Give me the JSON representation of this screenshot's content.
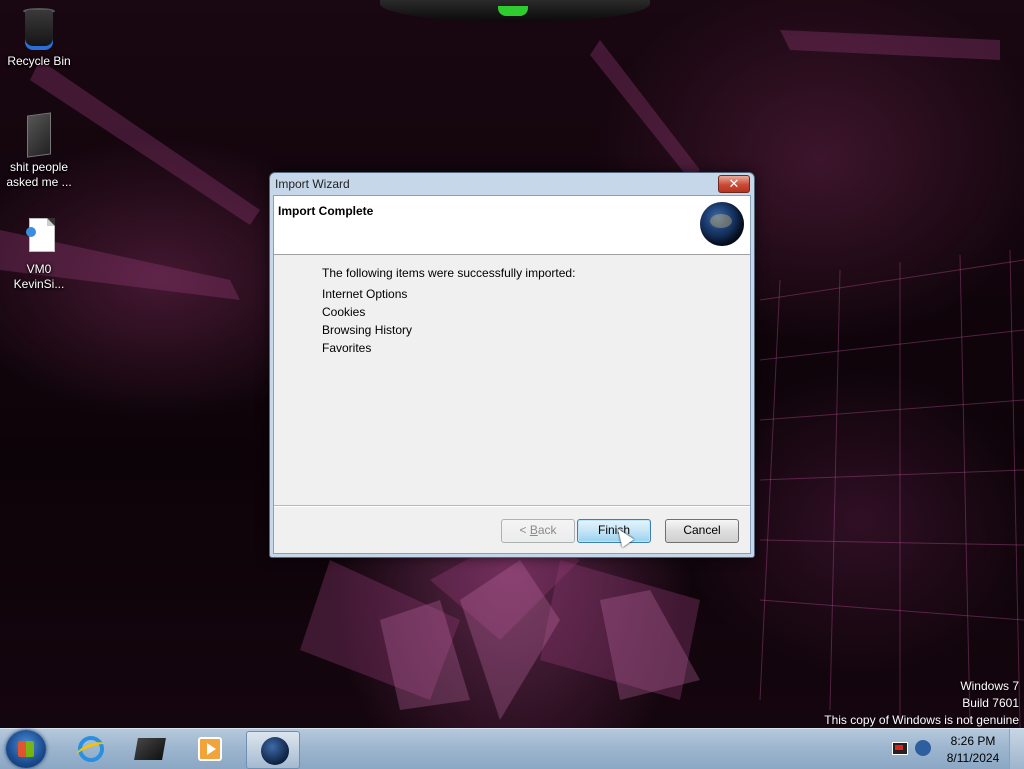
{
  "desktop": {
    "icons": [
      {
        "label": "Recycle Bin",
        "icon": "recycle-bin-icon"
      },
      {
        "label": "shit people asked me ...",
        "icon": "folder-icon"
      },
      {
        "label": "VM0 KevinSi...",
        "icon": "document-icon"
      }
    ]
  },
  "dialog": {
    "title": "Import Wizard",
    "close_label": "✕",
    "header": "Import Complete",
    "header_icon": "globe-icon",
    "intro": "The following items were successfully imported:",
    "items": [
      "Internet Options",
      "Cookies",
      "Browsing History",
      "Favorites"
    ],
    "buttons": {
      "back_prefix": "< ",
      "back_accel": "B",
      "back_rest": "ack",
      "finish": "Finish",
      "cancel": "Cancel"
    }
  },
  "watermark": {
    "line1": "Windows 7",
    "line2": "Build 7601",
    "line3": "This copy of Windows is not genuine"
  },
  "taskbar": {
    "start": "windows-start-icon",
    "pinned": [
      "internet-explorer-icon",
      "box-app-icon",
      "media-player-icon"
    ],
    "active": "globe-app-icon",
    "clock": {
      "time": "8:26 PM",
      "date": "8/11/2024"
    }
  }
}
